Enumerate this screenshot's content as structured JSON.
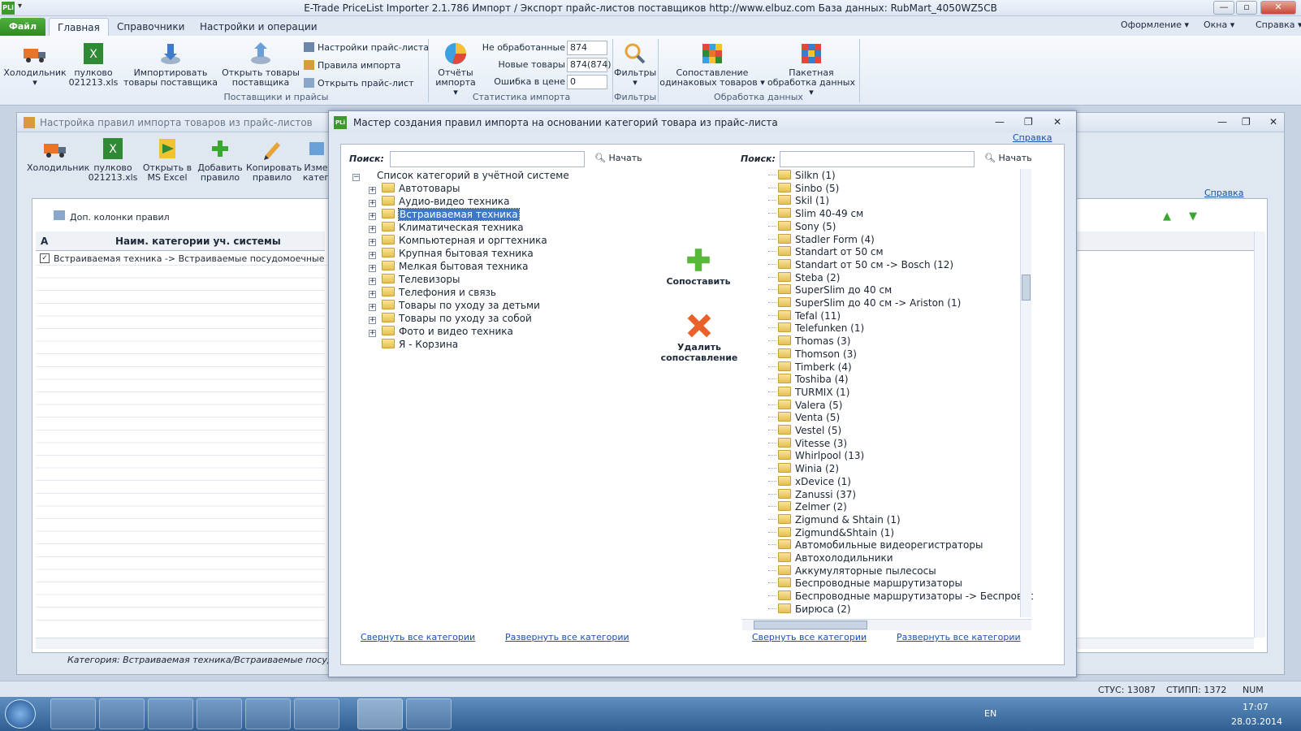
{
  "titlebar": {
    "icon": "PLi",
    "quick_access": "▾",
    "title": "E-Trade PriceList Importer 2.1.786   Импорт / Экспорт прайс-листов поставщиков   http://www.elbuz.com   База данных: RubMart_4050WZ5CB",
    "minimize": "—",
    "maximize": "▫",
    "close": "✕"
  },
  "ribbon_tabs": {
    "file": "Файл",
    "tabs": [
      "Главная",
      "Справочники",
      "Настройки и операции"
    ],
    "right": [
      "Оформление",
      "Окна",
      "Справка"
    ]
  },
  "ribbon": {
    "supplier": "Холодильник",
    "pricelist": "пулково 021213.xls",
    "import_goods": "Импортировать товары поставщика",
    "open_goods": "Открыть товары поставщика",
    "small": [
      "Настройки прайс-листа",
      "Правила импорта",
      "Открыть прайс-лист"
    ],
    "group_suppliers": "Поставщики и прайсы",
    "reports": "Отчёты импорта",
    "stats": [
      {
        "label": "Не обработанные",
        "value": "874"
      },
      {
        "label": "Новые товары",
        "value": "874(874)"
      },
      {
        "label": "Ошибка в цене",
        "value": "0"
      }
    ],
    "group_stats": "Статистика импорта",
    "filters": "Фильтры",
    "group_filters": "Фильтры",
    "match": "Сопоставление одинаковых товаров",
    "batch": "Пакетная обработка данных",
    "group_processing": "Обработка данных"
  },
  "mdi": {
    "title": "Настройка правил импорта товаров из прайс-листов",
    "toolbar": [
      "Холодильник",
      "пулково 021213.xls",
      "Открыть в MS Excel",
      "Добавить правило",
      "Копировать правило",
      "Изме катег"
    ],
    "help": "Справка",
    "extra_columns": "Доп. колонки правил",
    "col_a": "A",
    "col_name": "Наим. категории уч. системы",
    "row1": "Встраиваемая техника -> Встраиваемые посудомоечные машины",
    "footer": "Категория: Встраиваемая техника/Встраиваемые посудомое"
  },
  "dialog": {
    "title": "Мастер создания правил импорта на основании категорий товара из прайс-листа",
    "help": "Справка",
    "search_label": "Поиск:",
    "search_button": "Начать",
    "left_root": "Список категорий в учётной системе",
    "left_items": [
      "Автотовары",
      "Аудио-видео техника",
      "Встраиваемая техника",
      "Климатическая техника",
      "Компьютерная и оргтехника",
      "Крупная бытовая техника",
      "Мелкая бытовая техника",
      "Телевизоры",
      "Телефония и связь",
      "Товары по уходу за детьми",
      "Товары по уходу за собой",
      "Фото и видео техника",
      "Я - Корзина"
    ],
    "sync": "",
    "match_button": "Сопоставить",
    "delete_button": "Удалить сопоставление",
    "right_items": [
      "Silkn (1)",
      "Sinbo (5)",
      "Skil (1)",
      "Slim 40-49 см",
      "Sony (5)",
      "Stadler Form (4)",
      "Standart от 50 см",
      "Standart от 50 см -> Bosch (12)",
      "Steba (2)",
      "SuperSlim до 40 см",
      "SuperSlim до 40 см -> Ariston (1)",
      "Tefal (11)",
      "Telefunken (1)",
      "Thomas (3)",
      "Thomson (3)",
      "Timberk (4)",
      "Toshiba (4)",
      "TURMIX (1)",
      "Valera (5)",
      "Venta (5)",
      "Vestel (5)",
      "Vitesse (3)",
      "Whirlpool (13)",
      "Winia (2)",
      "xDevice (1)",
      "Zanussi (37)",
      "Zelmer (2)",
      "Zigmund & Shtain (1)",
      "Zigmund&Shtain (1)",
      "Автомобильные видеорегистраторы",
      "Автохолодильники",
      "Аккумуляторные пылесосы",
      "Беспроводные маршрутизаторы",
      "Беспроводные маршрутизаторы -> Беспроводные м",
      "Бирюса (2)"
    ],
    "collapse": "Свернуть все категории",
    "expand": "Развернуть все категории"
  },
  "statusbar": {
    "stus": "СТУС: 13087",
    "stipp": "СТИПП: 1372",
    "num": "NUM"
  },
  "taskbar": {
    "lang": "EN",
    "time": "17:07",
    "date": "28.03.2014"
  }
}
